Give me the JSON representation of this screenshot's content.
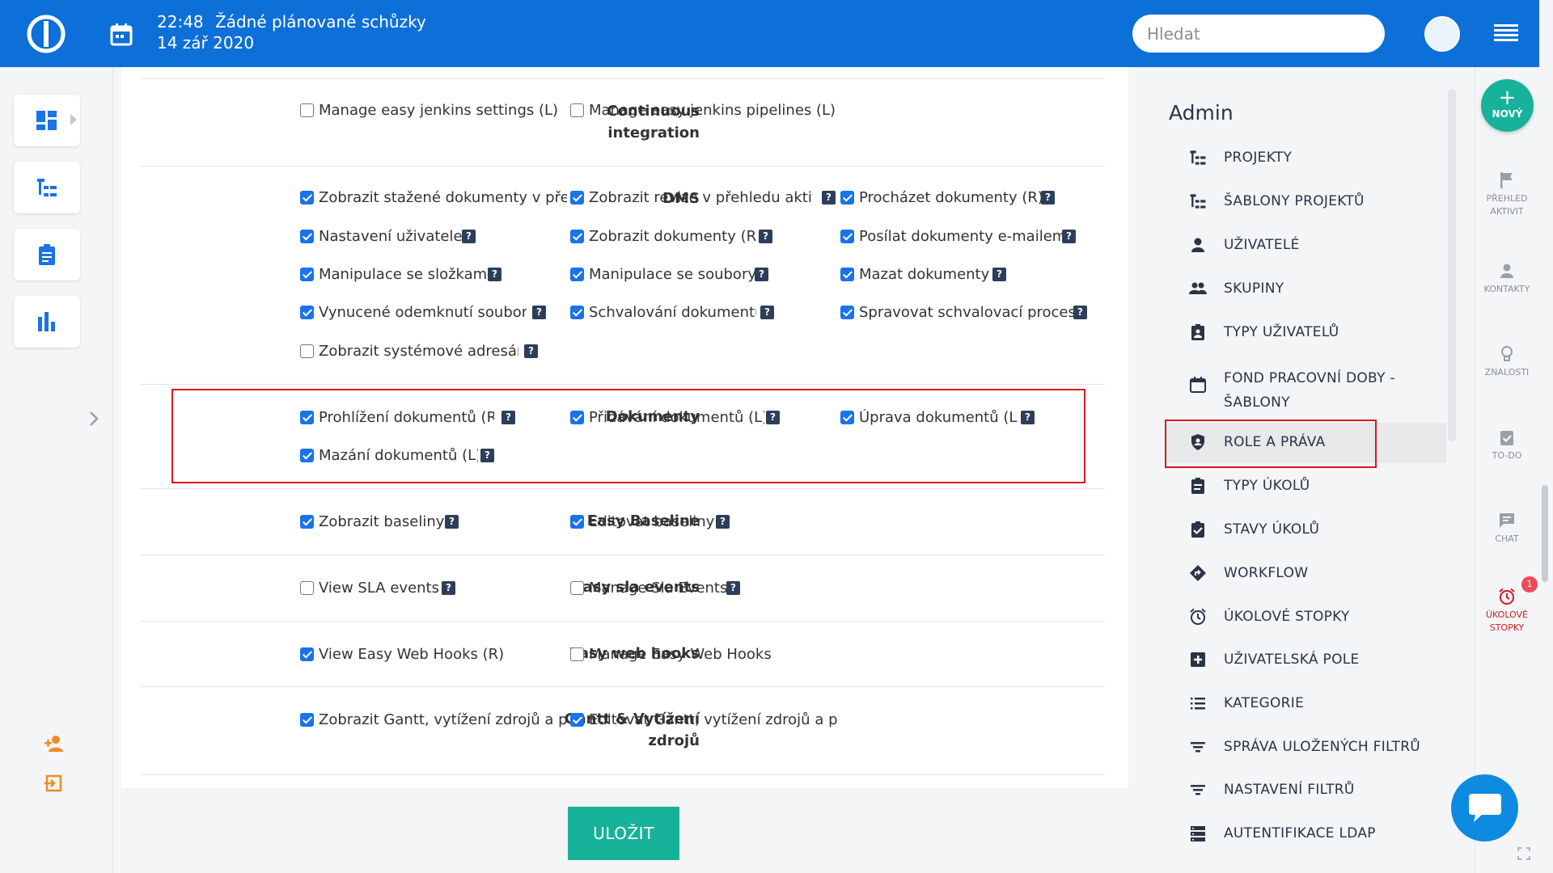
{
  "topbar": {
    "time": "22:48",
    "meetings": "Žádné plánované schůzky",
    "date": "14 zář 2020",
    "search_placeholder": "Hledat"
  },
  "groups": [
    {
      "name_lines": [
        "Continuous",
        "integration"
      ],
      "items": [
        {
          "label": "Manage easy jenkins settings (L)",
          "checked": false,
          "help": false
        },
        {
          "label": "Manage easy jenkins pipelines (L)",
          "checked": false,
          "help": false
        }
      ]
    },
    {
      "name": "DMS",
      "items": [
        {
          "label": "Zobrazit stažené dokumenty v přehle",
          "checked": true,
          "help": false
        },
        {
          "label": "Zobrazit revize v přehledu aktivit",
          "checked": true,
          "help": true
        },
        {
          "label": "Procházet dokumenty (R)",
          "checked": true,
          "help": true
        },
        {
          "label": "Nastavení uživatele",
          "checked": true,
          "help": true
        },
        {
          "label": "Zobrazit dokumenty (R)",
          "checked": true,
          "help": true
        },
        {
          "label": "Posílat dokumenty e-mailem",
          "checked": true,
          "help": true
        },
        {
          "label": "Manipulace se složkami",
          "checked": true,
          "help": true
        },
        {
          "label": "Manipulace se soubory",
          "checked": true,
          "help": true
        },
        {
          "label": "Mazat dokumenty",
          "checked": true,
          "help": true
        },
        {
          "label": "Vynucené odemknutí souboru",
          "checked": true,
          "help": true
        },
        {
          "label": "Schvalování dokumentů",
          "checked": true,
          "help": true
        },
        {
          "label": "Spravovat schvalovací procesy",
          "checked": true,
          "help": true
        },
        {
          "label": "Zobrazit systémové adresáře",
          "checked": false,
          "help": true
        }
      ]
    },
    {
      "name": "Dokumenty",
      "items": [
        {
          "label": "Prohlížení dokumentů (R)",
          "checked": true,
          "help": true
        },
        {
          "label": "Přidávání dokumentů (L)",
          "checked": true,
          "help": true
        },
        {
          "label": "Úprava dokumentů (L)",
          "checked": true,
          "help": true
        },
        {
          "label": "Mazání dokumentů (L)",
          "checked": true,
          "help": true
        }
      ]
    },
    {
      "name": "Easy Baseline",
      "items": [
        {
          "label": "Zobrazit baseliny",
          "checked": true,
          "help": true
        },
        {
          "label": "Editovat baseliny",
          "checked": true,
          "help": true
        }
      ]
    },
    {
      "name": "Easy sla events",
      "items": [
        {
          "label": "View SLA events",
          "checked": false,
          "help": true
        },
        {
          "label": "Manage Sla Events",
          "checked": false,
          "help": true
        }
      ]
    },
    {
      "name": "Easy web hooks",
      "items": [
        {
          "label": "View Easy Web Hooks (R)",
          "checked": true,
          "help": false
        },
        {
          "label": "Manage Easy Web Hooks",
          "checked": false,
          "help": false
        }
      ]
    },
    {
      "name_lines": [
        "Gantt & Vytížení",
        "zdrojů"
      ],
      "items": [
        {
          "label": "Zobrazit Gantt, vytížení zdrojů a plánova",
          "checked": true,
          "help": false
        },
        {
          "label": "Editovat Gantt, vytížení zdrojů a plánova",
          "checked": true,
          "help": false
        }
      ]
    }
  ],
  "save_label": "ULOŽIT",
  "admin": {
    "title": "Admin",
    "items": [
      {
        "label": "PROJEKTY",
        "icon": "project-tree-icon"
      },
      {
        "label": "ŠABLONY PROJEKTŮ",
        "icon": "project-tree-icon"
      },
      {
        "label": "UŽIVATELÉ",
        "icon": "user-icon"
      },
      {
        "label": "SKUPINY",
        "icon": "group-icon"
      },
      {
        "label": "TYPY UŽIVATELŮ",
        "icon": "badge-icon"
      },
      {
        "label_lines": [
          "FOND PRACOVNÍ DOBY -",
          "ŠABLONY"
        ],
        "icon": "calendar-icon"
      },
      {
        "label": "ROLE A PRÁVA",
        "icon": "shield-icon",
        "active": true
      },
      {
        "label": "TYPY ÚKOLŮ",
        "icon": "clipboard-icon"
      },
      {
        "label": "STAVY ÚKOLŮ",
        "icon": "clipboard-check-icon"
      },
      {
        "label": "WORKFLOW",
        "icon": "diamond-arrow-icon"
      },
      {
        "label": "ÚKOLOVÉ STOPKY",
        "icon": "alarm-icon"
      },
      {
        "label": "UŽIVATELSKÁ POLE",
        "icon": "plus-box-icon"
      },
      {
        "label": "KATEGORIE",
        "icon": "list-icon"
      },
      {
        "label": "SPRÁVA ULOŽENÝCH FILTRŮ",
        "icon": "filter-icon"
      },
      {
        "label": "NASTAVENÍ FILTRŮ",
        "icon": "filter-icon"
      },
      {
        "label": "AUTENTIFIKACE LDAP",
        "icon": "server-icon"
      }
    ]
  },
  "rightbar": {
    "new_label": "NOVÝ",
    "items": [
      {
        "label_lines": [
          "PŘEHLED",
          "AKTIVIT"
        ],
        "icon": "flag-icon"
      },
      {
        "label_lines": [
          "KONTAKTY"
        ],
        "icon": "contact-icon"
      },
      {
        "label_lines": [
          "ZNALOSTI"
        ],
        "icon": "bulb-icon"
      },
      {
        "label_lines": [
          "TO-DO"
        ],
        "icon": "todo-icon"
      },
      {
        "label_lines": [
          "CHAT"
        ],
        "icon": "chat-icon"
      },
      {
        "label_lines": [
          "ÚKOLOVÉ",
          "STOPKY"
        ],
        "icon": "alarm-icon",
        "badge": "1"
      }
    ]
  },
  "colors": {
    "primary": "#0d6fd8",
    "accent": "#16b39a",
    "highlight": "#d71920",
    "checkbox": "#1a73e8"
  }
}
